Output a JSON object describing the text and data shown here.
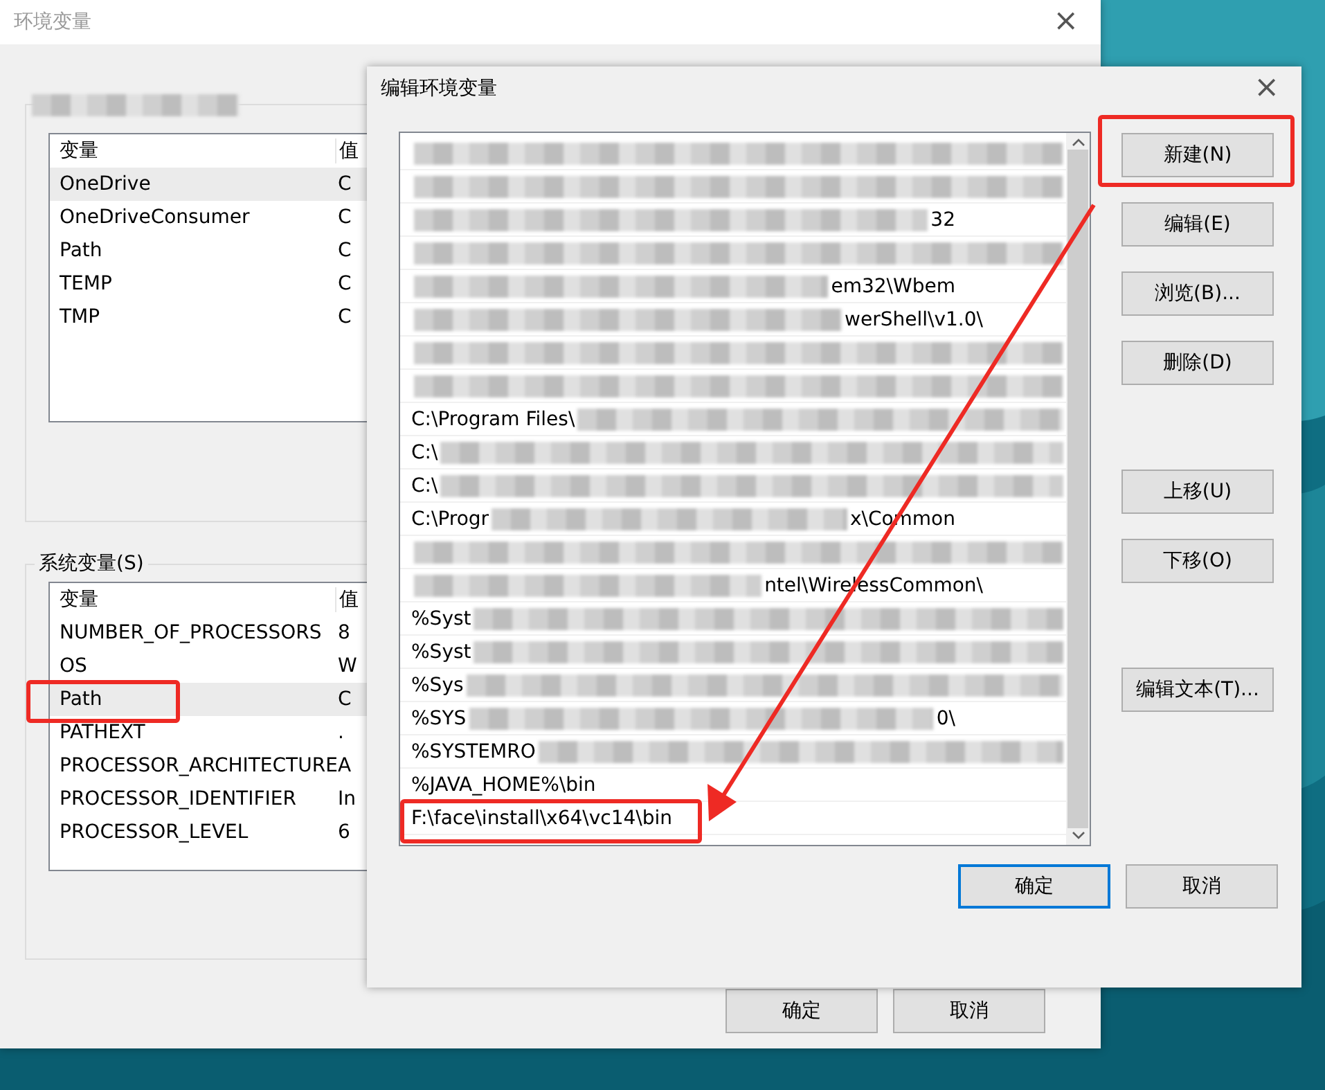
{
  "main_window": {
    "title": "环境变量",
    "close": "×",
    "user_vars": {
      "columns": [
        "变量",
        "值"
      ],
      "rows": [
        {
          "name": "OneDrive",
          "value": "C",
          "selected": true,
          "highlighted": false
        },
        {
          "name": "OneDriveConsumer",
          "value": "C",
          "selected": false,
          "highlighted": false
        },
        {
          "name": "Path",
          "value": "C",
          "selected": false,
          "highlighted": false
        },
        {
          "name": "TEMP",
          "value": "C",
          "selected": false,
          "highlighted": false
        },
        {
          "name": "TMP",
          "value": "C",
          "selected": false,
          "highlighted": false
        }
      ]
    },
    "system_vars": {
      "title": "系统变量(S)",
      "columns": [
        "变量",
        "值"
      ],
      "rows": [
        {
          "name": "NUMBER_OF_PROCESSORS",
          "value": "8",
          "selected": false,
          "highlighted": false
        },
        {
          "name": "OS",
          "value": "W",
          "selected": false,
          "highlighted": false
        },
        {
          "name": "Path",
          "value": "C",
          "selected": true,
          "highlighted": true
        },
        {
          "name": "PATHEXT",
          "value": ".",
          "selected": false,
          "highlighted": false
        },
        {
          "name": "PROCESSOR_ARCHITECTURE",
          "value": "A",
          "selected": false,
          "highlighted": false
        },
        {
          "name": "PROCESSOR_IDENTIFIER",
          "value": "In",
          "selected": false,
          "highlighted": false
        },
        {
          "name": "PROCESSOR_LEVEL",
          "value": "6",
          "selected": false,
          "highlighted": false
        }
      ]
    },
    "buttons": [
      "确定",
      "取消"
    ]
  },
  "edit_dialog": {
    "title": "编辑环境变量",
    "close": "×",
    "paths": [
      {
        "redacted": true,
        "highlighted": false
      },
      {
        "redacted": true,
        "highlighted": false
      },
      {
        "redacted": true,
        "tail": "32",
        "highlighted": false
      },
      {
        "redacted": true,
        "highlighted": false
      },
      {
        "redacted": true,
        "tail": "em32\\Wbem",
        "highlighted": false
      },
      {
        "redacted": true,
        "tail": "werShell\\v1.0\\",
        "highlighted": false
      },
      {
        "redacted": true,
        "highlighted": false
      },
      {
        "redacted": true,
        "highlighted": false
      },
      {
        "lead": "C:\\Program Files\\",
        "redacted": true,
        "highlighted": false
      },
      {
        "lead": "C:\\",
        "redacted": true,
        "highlighted": false
      },
      {
        "lead": "C:\\",
        "redacted": true,
        "highlighted": false
      },
      {
        "lead": "C:\\Progr",
        "redacted": true,
        "tail": "x\\Common",
        "highlighted": false
      },
      {
        "redacted": true,
        "highlighted": false
      },
      {
        "redacted": true,
        "tail": "ntel\\WirelessCommon\\",
        "highlighted": false
      },
      {
        "lead": "%Syst",
        "redacted": true,
        "highlighted": false
      },
      {
        "lead": "%Syst",
        "redacted": true,
        "highlighted": false
      },
      {
        "lead": "%Sys",
        "redacted": true,
        "highlighted": false
      },
      {
        "lead": "%SYS",
        "redacted": true,
        "tail": "0\\",
        "highlighted": false
      },
      {
        "lead": "%SYSTEMRO",
        "redacted": true,
        "highlighted": false
      },
      {
        "lead": "%JAVA_HOME%\\bin",
        "redacted": false,
        "highlighted": false
      },
      {
        "lead": "F:\\face\\install\\x64\\vc14\\bin",
        "redacted": false,
        "highlighted": true
      }
    ],
    "side_buttons": [
      {
        "label": "新建(N)",
        "highlighted": true
      },
      {
        "label": "编辑(E)",
        "highlighted": false
      },
      {
        "label": "浏览(B)...",
        "highlighted": false
      },
      {
        "label": "删除(D)",
        "highlighted": false
      },
      {
        "label": "上移(U)",
        "highlighted": false
      },
      {
        "label": "下移(O)",
        "highlighted": false
      },
      {
        "label": "编辑文本(T)...",
        "highlighted": false
      }
    ],
    "ok": "确定",
    "cancel": "取消"
  }
}
